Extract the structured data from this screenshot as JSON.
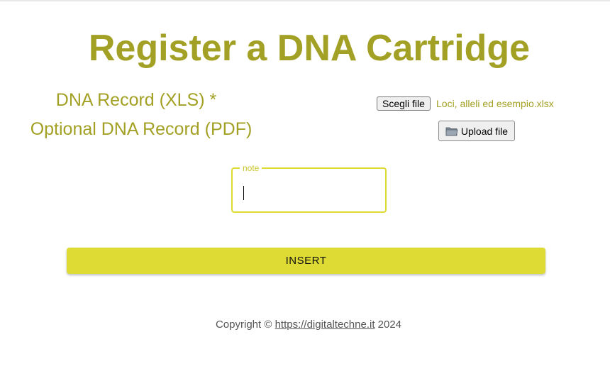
{
  "page": {
    "title": "Register a DNA Cartridge"
  },
  "form": {
    "xls_label": "DNA Record (XLS) *",
    "pdf_label": "Optional DNA Record (PDF)",
    "choose_file_label": "Scegli file",
    "selected_file_name": "Loci, alleli ed esempio.xlsx",
    "upload_label": "Upload file",
    "note_label": "note",
    "note_value": "",
    "submit_label": "INSERT"
  },
  "footer": {
    "prefix": "Copyright ©",
    "link_text": "https://digitaltechne.it",
    "year": "2024"
  },
  "colors": {
    "title_text": "#a3a125",
    "accent_yellow": "#dedb34"
  },
  "icons": {
    "upload": "folder-icon"
  }
}
